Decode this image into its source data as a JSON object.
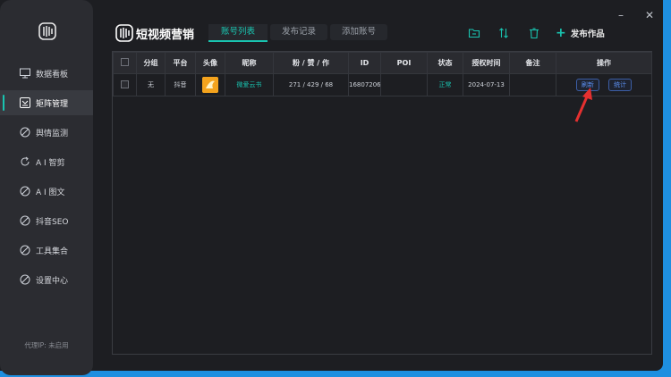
{
  "sidebar": {
    "items": [
      {
        "label": "数据看板",
        "icon": "monitor-icon",
        "active": false
      },
      {
        "label": "矩阵管理",
        "icon": "matrix-icon",
        "active": true
      },
      {
        "label": "舆情监测",
        "icon": "disabled-icon",
        "active": false
      },
      {
        "label": "A I 智剪",
        "icon": "refresh-icon",
        "active": false
      },
      {
        "label": "A I 图文",
        "icon": "disabled-icon",
        "active": false
      },
      {
        "label": "抖音SEO",
        "icon": "disabled-icon",
        "active": false
      },
      {
        "label": "工具集合",
        "icon": "disabled-icon",
        "active": false
      },
      {
        "label": "设置中心",
        "icon": "disabled-icon",
        "active": false
      }
    ],
    "proxy_text": "代理IP: 未启用"
  },
  "brand": {
    "title": "短视频营销"
  },
  "tabs": [
    {
      "label": "账号列表",
      "active": true
    },
    {
      "label": "发布记录",
      "active": false
    },
    {
      "label": "添加账号",
      "active": false
    }
  ],
  "toolbar": {
    "publish_label": "发布作品",
    "icons": [
      "folder-icon",
      "sort-icon",
      "trash-icon"
    ]
  },
  "window": {
    "minimize": "–",
    "close": "✕"
  },
  "table": {
    "headers": [
      "分组",
      "平台",
      "头像",
      "昵称",
      "粉 / 赞 / 作",
      "ID",
      "POI",
      "状态",
      "授权时间",
      "备注",
      "操作"
    ],
    "rows": [
      {
        "group": "无",
        "platform": "抖音",
        "nickname": "微爱云书",
        "stats": "271 / 429 / 68",
        "id": "16807206",
        "poi": "",
        "status": "正常",
        "auth_time": "2024-07-13",
        "note": "",
        "actions": [
          "刷新",
          "统计"
        ]
      }
    ]
  },
  "colors": {
    "accent": "#19c4b0",
    "background": "#1d1e22",
    "frame": "#1e8fe0",
    "annotation": "#e53030"
  }
}
